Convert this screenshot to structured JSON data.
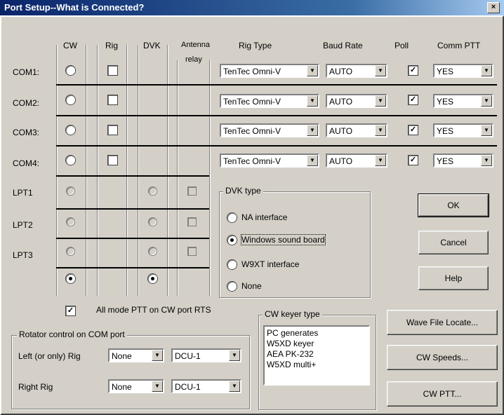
{
  "window": {
    "title": "Port Setup--What is Connected?",
    "close_glyph": "×"
  },
  "columns": {
    "cw": "CW",
    "rig": "Rig",
    "dvk": "DVK",
    "antenna_relay_1": "Antenna",
    "antenna_relay_2": "relay",
    "rig_type": "Rig Type",
    "baud_rate": "Baud Rate",
    "poll": "Poll",
    "comm_ptt": "Comm PTT"
  },
  "com_ports": [
    {
      "label": "COM1:",
      "rig_type": "TenTec Omni-V",
      "baud": "AUTO",
      "poll_mark": "✓",
      "ptt": "YES"
    },
    {
      "label": "COM2:",
      "rig_type": "TenTec Omni-V",
      "baud": "AUTO",
      "poll_mark": "✓",
      "ptt": "YES"
    },
    {
      "label": "COM3:",
      "rig_type": "TenTec Omni-V",
      "baud": "AUTO",
      "poll_mark": "✓",
      "ptt": "YES"
    },
    {
      "label": "COM4:",
      "rig_type": "TenTec Omni-V",
      "baud": "AUTO",
      "poll_mark": "✓",
      "ptt": "YES"
    }
  ],
  "lpt_ports": [
    {
      "label": "LPT1"
    },
    {
      "label": "LPT2"
    },
    {
      "label": "LPT3"
    }
  ],
  "dvk_type": {
    "title": "DVK type",
    "options": [
      "NA interface",
      "Windows sound board",
      "W9XT interface",
      "None"
    ],
    "selected": "Windows sound board"
  },
  "buttons": {
    "ok": "OK",
    "cancel": "Cancel",
    "help": "Help",
    "wave_file_locate": "Wave File Locate...",
    "cw_speeds": "CW Speeds...",
    "cw_ptt": "CW PTT..."
  },
  "all_mode_ptt": {
    "label": "All mode PTT on CW port RTS",
    "mark": "✓"
  },
  "cw_keyer": {
    "title": "CW keyer type",
    "items": [
      "PC generates",
      "W5XD keyer",
      "AEA PK-232",
      "W5XD multi+"
    ]
  },
  "rotator": {
    "title": "Rotator control on COM port",
    "left_label": "Left (or only) Rig",
    "left_port": "None",
    "left_type": "DCU-1",
    "right_label": "Right Rig",
    "right_port": "None",
    "right_type": "DCU-1"
  }
}
